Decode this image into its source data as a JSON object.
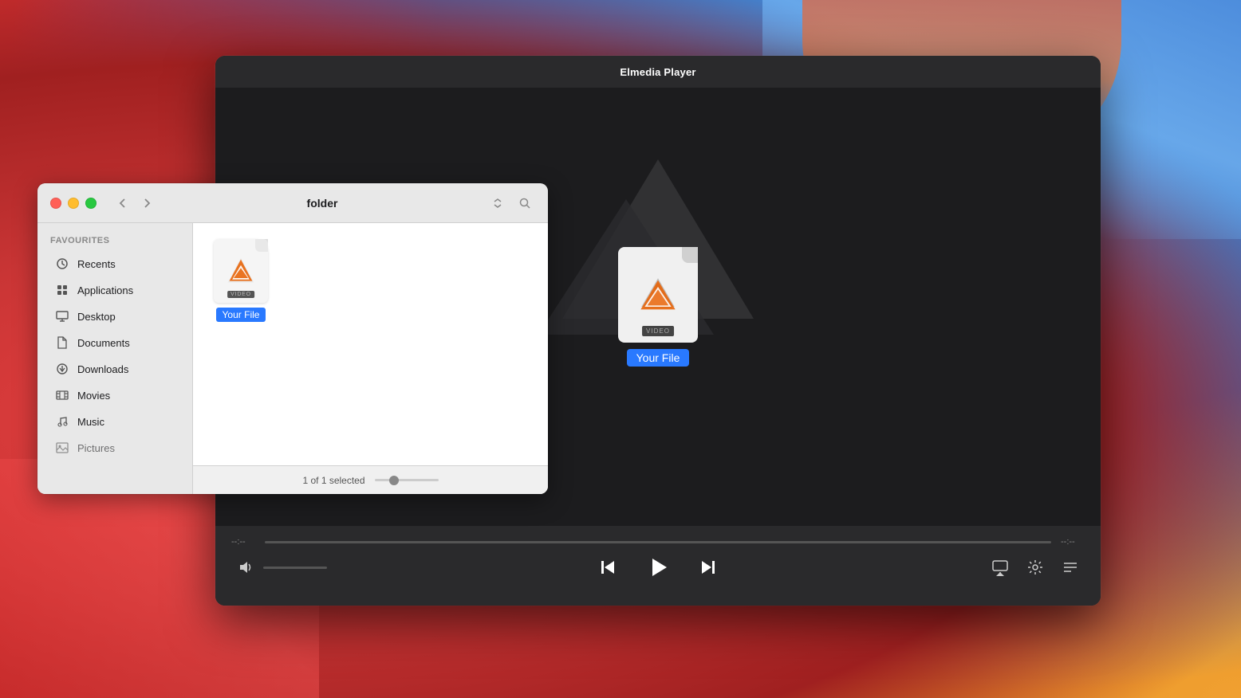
{
  "desktop": {
    "background": "macOS Big Sur gradient"
  },
  "player": {
    "title": "Elmedia Player",
    "file_name": "Your File",
    "file_type": "VIDEO",
    "time_start": "--:--",
    "time_end": "--:--"
  },
  "finder": {
    "title": "folder",
    "status_text": "1 of 1 selected",
    "favourites_label": "Favourites",
    "sidebar_items": [
      {
        "id": "recents",
        "label": "Recents",
        "icon": "clock"
      },
      {
        "id": "applications",
        "label": "Applications",
        "icon": "grid"
      },
      {
        "id": "desktop",
        "label": "Desktop",
        "icon": "monitor"
      },
      {
        "id": "documents",
        "label": "Documents",
        "icon": "file"
      },
      {
        "id": "downloads",
        "label": "Downloads",
        "icon": "download"
      },
      {
        "id": "movies",
        "label": "Movies",
        "icon": "film"
      },
      {
        "id": "music",
        "label": "Music",
        "icon": "music"
      },
      {
        "id": "pictures",
        "label": "Pictures",
        "icon": "image"
      }
    ],
    "file": {
      "name": "Your File",
      "type": "VIDEO"
    }
  },
  "controls": {
    "prev_label": "⏮",
    "play_label": "▶",
    "next_label": "⏭",
    "airplay_label": "airplay",
    "settings_label": "settings",
    "playlist_label": "playlist"
  }
}
